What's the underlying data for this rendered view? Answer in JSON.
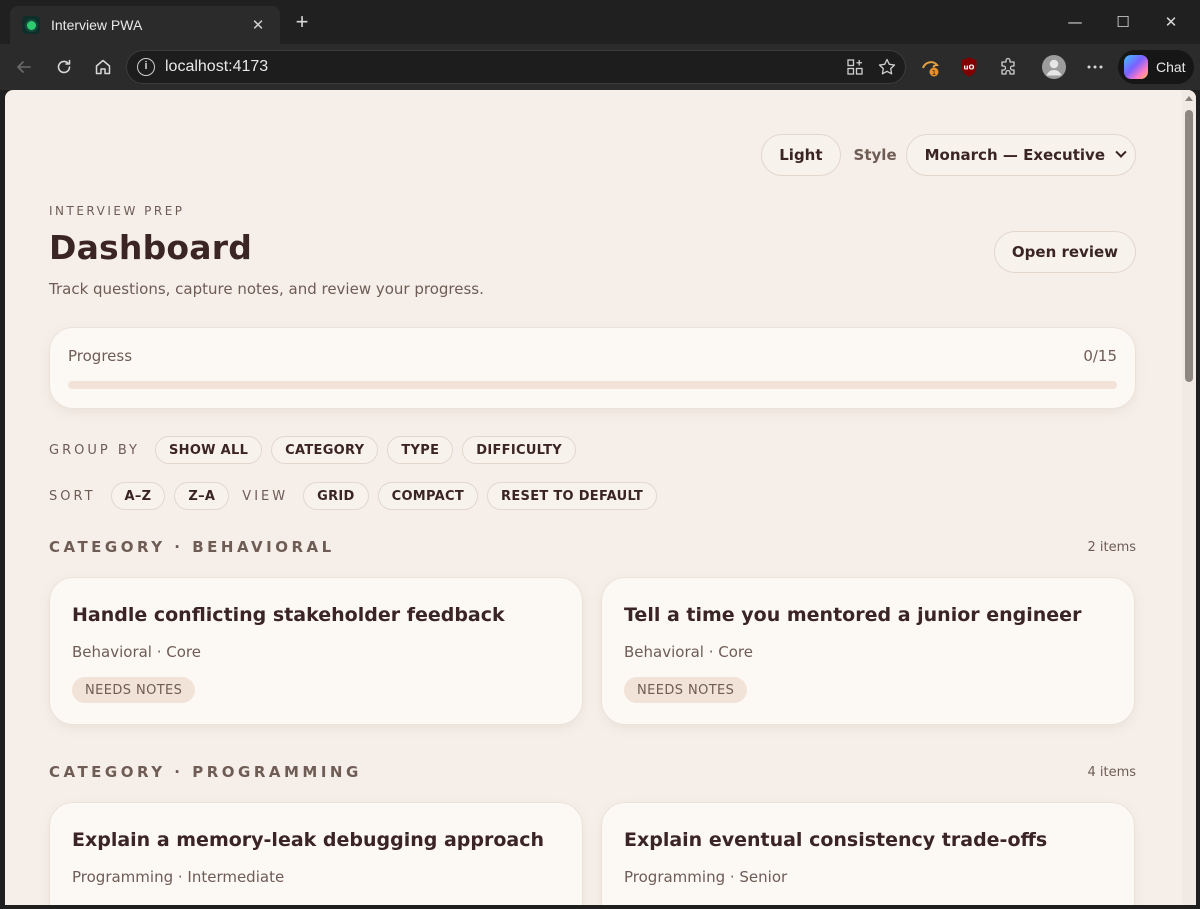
{
  "browser": {
    "tab_title": "Interview PWA",
    "tab_close": "✕",
    "new_tab": "+",
    "url": "localhost:4173",
    "chat_label": "Chat",
    "window_controls": [
      "—",
      "☐",
      "✕"
    ]
  },
  "header": {
    "theme_button": "Light",
    "style_label": "Style",
    "style_select_value": "Monarch — Executive",
    "eyebrow": "INTERVIEW PREP",
    "title": "Dashboard",
    "subtitle": "Track questions, capture notes, and review your progress.",
    "open_review": "Open review"
  },
  "progress": {
    "label": "Progress",
    "count": "0/15",
    "fraction": 0
  },
  "controls": {
    "group_by_label": "GROUP BY",
    "group_by": [
      "SHOW ALL",
      "CATEGORY",
      "TYPE",
      "DIFFICULTY"
    ],
    "sort_label": "SORT",
    "sort": [
      "A–Z",
      "Z–A"
    ],
    "view_label": "VIEW",
    "view": [
      "GRID",
      "COMPACT"
    ],
    "reset": "RESET TO DEFAULT"
  },
  "sections": [
    {
      "title": "CATEGORY · BEHAVIORAL",
      "count": "2 items",
      "cards": [
        {
          "title": "Handle conflicting stakeholder feedback",
          "meta": "Behavioral · Core",
          "badge": "NEEDS NOTES"
        },
        {
          "title": "Tell a time you mentored a junior engineer",
          "meta": "Behavioral · Core",
          "badge": "NEEDS NOTES"
        }
      ]
    },
    {
      "title": "CATEGORY · PROGRAMMING",
      "count": "4 items",
      "cards": [
        {
          "title": "Explain a memory-leak debugging approach",
          "meta": "Programming · Intermediate",
          "badge": ""
        },
        {
          "title": "Explain eventual consistency trade-offs",
          "meta": "Programming · Senior",
          "badge": ""
        }
      ]
    }
  ]
}
